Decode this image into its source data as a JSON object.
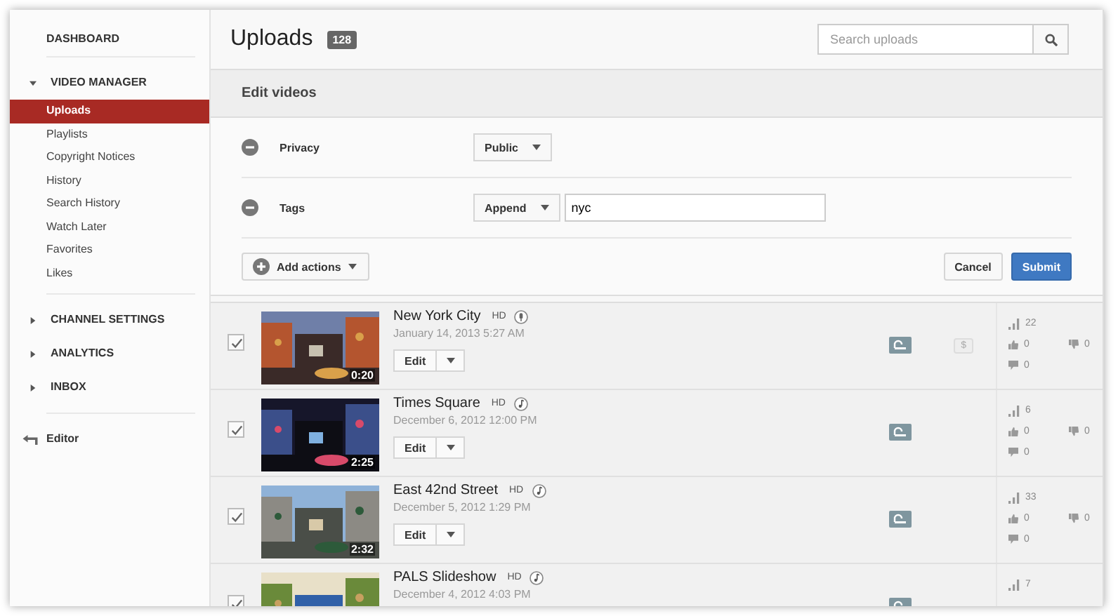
{
  "sidebar": [
    {
      "kind": "link",
      "label": "DASHBOARD"
    },
    {
      "kind": "section",
      "label": "VIDEO MANAGER",
      "expanded": true,
      "children": [
        {
          "label": "Uploads",
          "selected": true
        },
        {
          "label": "Playlists",
          "selected": false
        },
        {
          "label": "Copyright Notices",
          "selected": false
        },
        {
          "label": "History",
          "selected": false
        },
        {
          "label": "Search History",
          "selected": false
        },
        {
          "label": "Watch Later",
          "selected": false
        },
        {
          "label": "Favorites",
          "selected": false
        },
        {
          "label": "Likes",
          "selected": false
        }
      ]
    },
    {
      "kind": "section",
      "label": "CHANNEL SETTINGS",
      "expanded": false
    },
    {
      "kind": "section",
      "label": "ANALYTICS",
      "expanded": false
    },
    {
      "kind": "section",
      "label": "INBOX",
      "expanded": false
    },
    {
      "kind": "back",
      "label": "Editor"
    }
  ],
  "header": {
    "title": "Uploads",
    "count": "128",
    "search": {
      "placeholder": "Search uploads"
    }
  },
  "edit_panel": {
    "title": "Edit videos",
    "fields": [
      {
        "label": "Privacy",
        "dropdown": "Public"
      },
      {
        "label": "Tags",
        "dropdown": "Append",
        "value": "nyc"
      }
    ],
    "add_actions": "Add actions",
    "cancel": "Cancel",
    "submit": "Submit"
  },
  "videos": [
    {
      "checked": true,
      "duration": "0:20",
      "title": "New York City",
      "quality": "HD",
      "kind": "mic",
      "date": "January 14, 2013 5:27 AM",
      "edit": "Edit",
      "badge": "$",
      "views": "22",
      "likes": "0",
      "dislikes": "0",
      "comments": "0"
    },
    {
      "checked": true,
      "duration": "2:25",
      "title": "Times Square",
      "quality": "HD",
      "kind": "music",
      "date": "December 6, 2012 12:00 PM",
      "edit": "Edit",
      "views": "6",
      "likes": "0",
      "dislikes": "0",
      "comments": "0"
    },
    {
      "checked": true,
      "duration": "2:32",
      "title": "East 42nd Street",
      "quality": "HD",
      "kind": "music",
      "date": "December 5, 2012 1:29 PM",
      "edit": "Edit",
      "views": "33",
      "likes": "0",
      "dislikes": "0",
      "comments": "0"
    },
    {
      "checked": true,
      "title": "PALS Slideshow",
      "quality": "HD",
      "kind": "music",
      "date": "December 4, 2012 4:03 PM",
      "views": "7"
    }
  ]
}
